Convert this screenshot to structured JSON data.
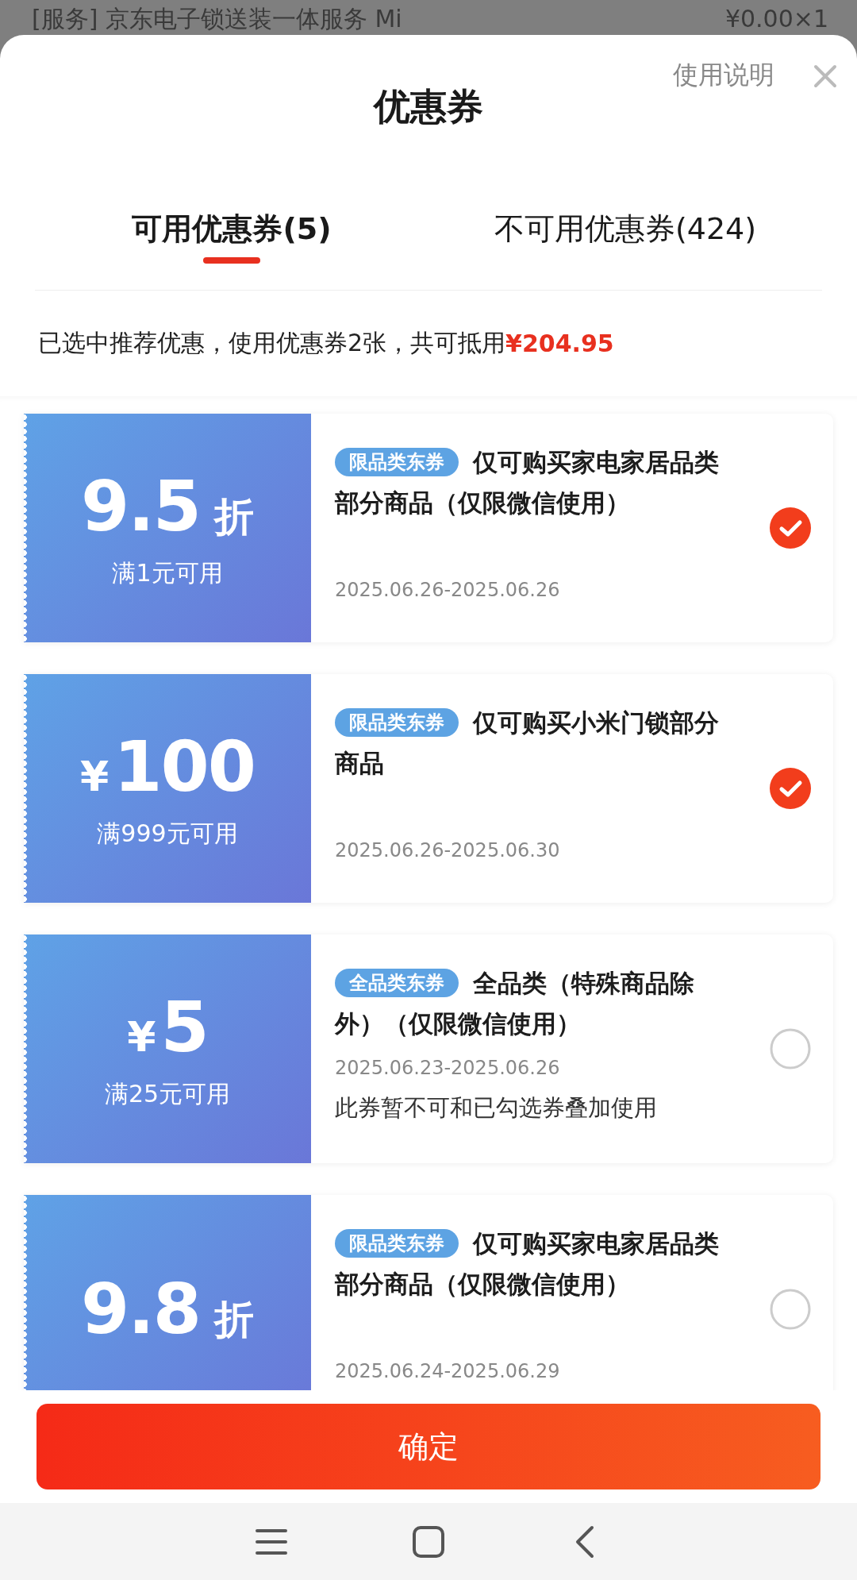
{
  "background_item": {
    "name": "[服务] 京东电子锁送装一体服务 Mi",
    "price": "¥0.00×1"
  },
  "sheet": {
    "title": "优惠券",
    "help_link": "使用说明"
  },
  "tabs": [
    {
      "label": "可用优惠券(5)",
      "selected": true
    },
    {
      "label": "不可用优惠券(424)",
      "selected": false
    }
  ],
  "summary": {
    "text": "已选中推荐优惠，使用优惠券2张，共可抵用",
    "amount": "¥204.95"
  },
  "coupons": [
    {
      "kind": "discount",
      "value": "9.5",
      "unit": "折",
      "condition": "满1元可用",
      "tag": "限品类东券",
      "title": "仅可购买家电家居品类部分商品（仅限微信使用）",
      "dates": "2025.06.26-2025.06.26",
      "selected": true
    },
    {
      "kind": "cash",
      "unit": "¥",
      "value": "100",
      "condition": "满999元可用",
      "tag": "限品类东券",
      "title": "仅可购买小米门锁部分商品",
      "dates": "2025.06.26-2025.06.30",
      "selected": true
    },
    {
      "kind": "cash",
      "unit": "¥",
      "value": "5",
      "condition": "满25元可用",
      "tag": "全品类东券",
      "title": "全品类（特殊商品除外）（仅限微信使用）",
      "dates": "2025.06.23-2025.06.26",
      "note": "此券暂不可和已勾选券叠加使用",
      "selected": false
    },
    {
      "kind": "discount",
      "value": "9.8",
      "unit": "折",
      "tag": "限品类东券",
      "title": "仅可购买家电家居品类部分商品（仅限微信使用）",
      "dates": "2025.06.24-2025.06.29",
      "selected": false
    }
  ],
  "confirm_button": "确定"
}
